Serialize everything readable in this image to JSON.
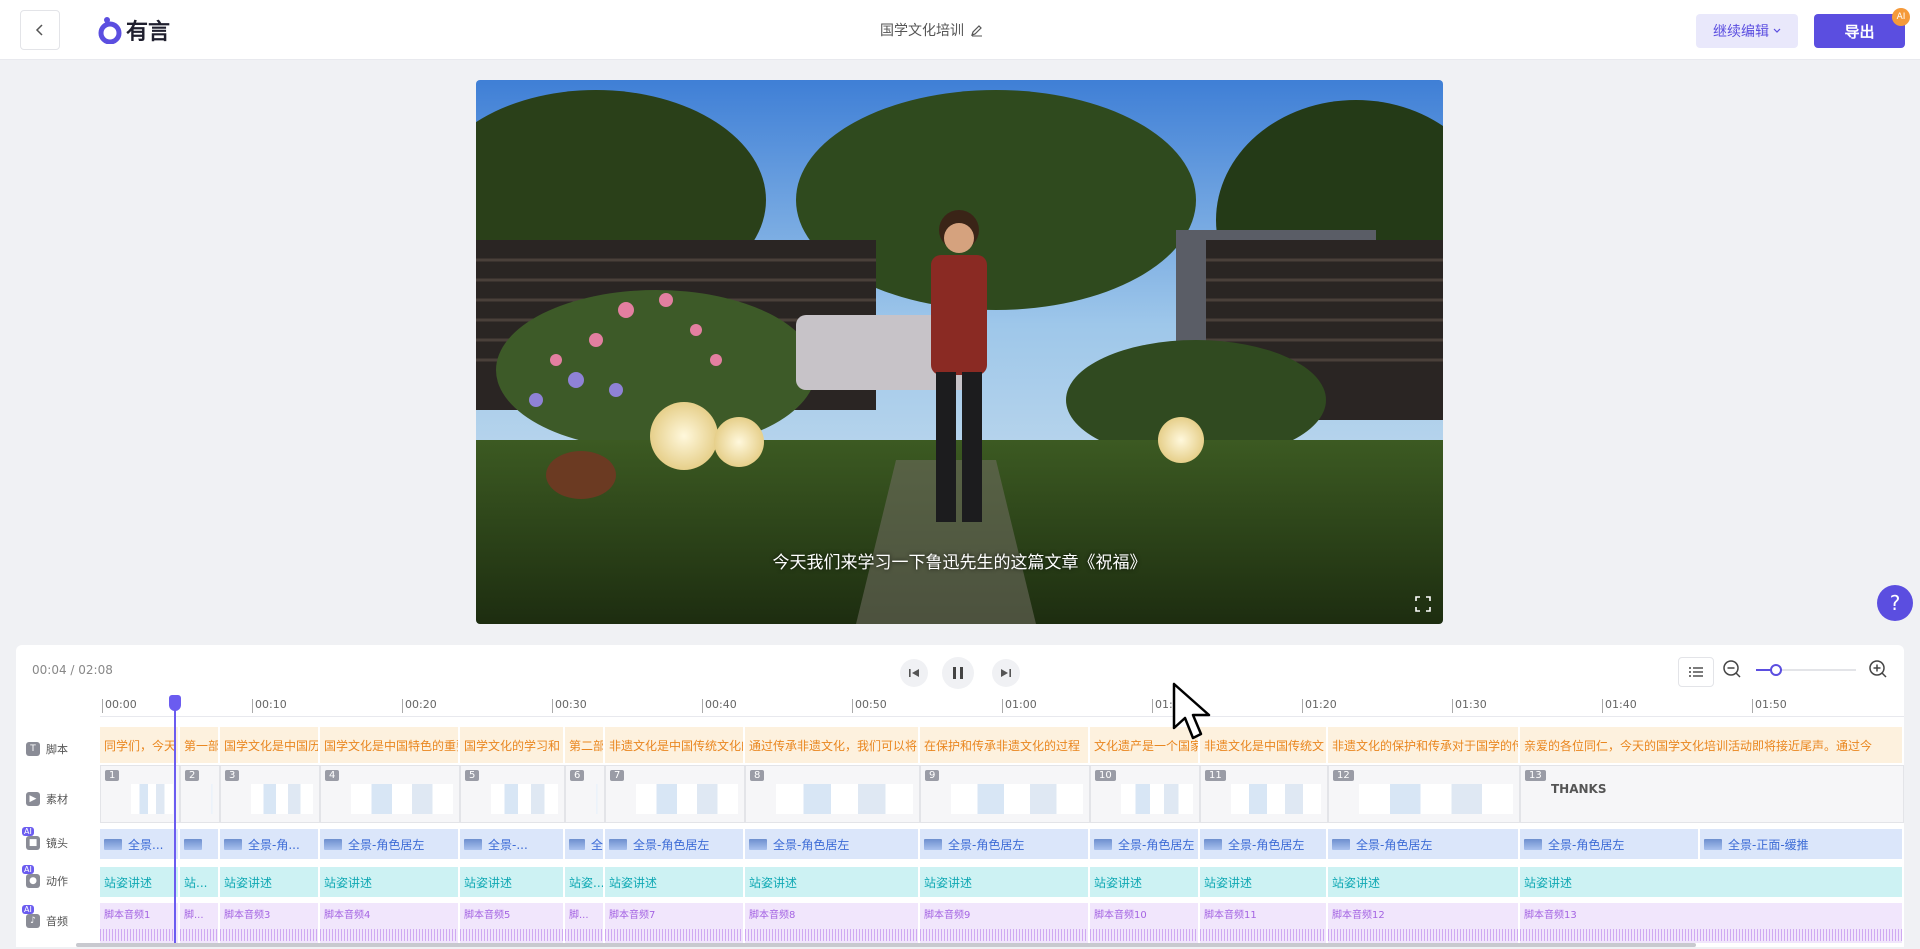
{
  "header": {
    "logo_text": "有言",
    "doc_title": "国学文化培训",
    "continue_label": "继续编辑",
    "export_label": "导出",
    "ai_badge": "AI"
  },
  "video": {
    "subtitle": "今天我们来学习一下鲁迅先生的这篇文章《祝福》"
  },
  "help": {
    "label": "?"
  },
  "timeline": {
    "time_readout": "00:04 / 02:08",
    "zoom_level": 0.2,
    "ruler_ticks": [
      "00:00",
      "00:10",
      "00:20",
      "00:30",
      "00:40",
      "00:50",
      "01:00",
      "01:10",
      "01:20",
      "01:30",
      "01:40",
      "01:50"
    ],
    "tracks": {
      "script": {
        "label": "脚本"
      },
      "material": {
        "label": "素材"
      },
      "camera": {
        "label": "镜头",
        "ai": "AI"
      },
      "action": {
        "label": "动作",
        "ai": "AI"
      },
      "audio": {
        "label": "音频",
        "ai": "AI"
      }
    },
    "script_segments": [
      "同学们，今天",
      "第一部",
      "国学文化是中国历",
      "国学文化是中国特色的重要",
      "国学文化的学习和",
      "第二部分",
      "非遗文化是中国传统文化的",
      "通过传承非遗文化，我们可以将",
      "在保护和传承非遗文化的过程",
      "文化遗产是一个国家或民",
      "非遗文化是中国传统文",
      "非遗文化的保护和传承对于国学的传",
      "亲爱的各位同仁，今天的国学文化培训活动即将接近尾声。通过今"
    ],
    "material_segments": [
      {
        "num": "1"
      },
      {
        "num": "2"
      },
      {
        "num": "3"
      },
      {
        "num": "4"
      },
      {
        "num": "5"
      },
      {
        "num": "6"
      },
      {
        "num": "7"
      },
      {
        "num": "8"
      },
      {
        "num": "9"
      },
      {
        "num": "10"
      },
      {
        "num": "11"
      },
      {
        "num": "12"
      },
      {
        "num": "13",
        "text": "THANKS"
      }
    ],
    "camera_segments": [
      "全景...",
      "",
      "全景-角...",
      "全景-角色居左",
      "全景-...",
      "全",
      "全景-角色居左",
      "全景-角色居左",
      "全景-角色居左",
      "全景-角色居左",
      "全景-角色居左",
      "全景-角色居左",
      "全景-角色居左",
      "全景-正面-缓推"
    ],
    "action_segments": [
      "站姿讲述",
      "站...",
      "站姿讲述",
      "站姿讲述",
      "站姿讲述",
      "站姿...",
      "站姿讲述",
      "站姿讲述",
      "站姿讲述",
      "站姿讲述",
      "站姿讲述",
      "站姿讲述",
      "站姿讲述"
    ],
    "audio_segments": [
      "脚本音频1",
      "脚...",
      "脚本音频3",
      "脚本音频4",
      "脚本音频5",
      "脚...",
      "脚本音频7",
      "脚本音频8",
      "脚本音频9",
      "脚本音频10",
      "脚本音频11",
      "脚本音频12",
      "脚本音频13"
    ]
  }
}
